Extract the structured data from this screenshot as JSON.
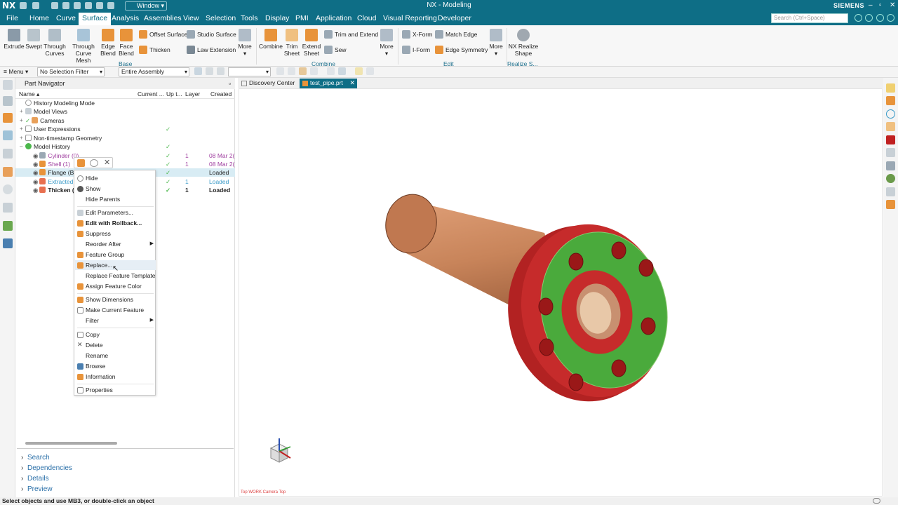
{
  "titlebar": {
    "logo": "NX",
    "window_menu": "Window",
    "title": "NX - Modeling",
    "brand": "SIEMENS"
  },
  "menubar": {
    "file": "File",
    "tabs": [
      "Home",
      "Curve",
      "Surface",
      "Analysis",
      "Assemblies",
      "View",
      "Selection",
      "Tools",
      "Display",
      "PMI",
      "Application",
      "Cloud",
      "Visual Reporting",
      "Developer"
    ],
    "active_tab": "Surface",
    "search_placeholder": "Search (Ctrl+Space)"
  },
  "ribbon": {
    "base": {
      "extrude": "Extrude",
      "swept": "Swept",
      "through_curves_1": "Through",
      "through_curves_2": "Curves",
      "through_mesh_1": "Through",
      "through_mesh_2": "Curve Mesh",
      "edge_blend_1": "Edge",
      "edge_blend_2": "Blend",
      "face_blend_1": "Face",
      "face_blend_2": "Blend",
      "offset_surface": "Offset Surface",
      "thicken": "Thicken",
      "studio_surface": "Studio Surface",
      "law_extension": "Law Extension",
      "more": "More",
      "group": "Base"
    },
    "combine": {
      "combine": "Combine",
      "trim_sheet_1": "Trim",
      "trim_sheet_2": "Sheet",
      "extend_sheet_1": "Extend",
      "extend_sheet_2": "Sheet",
      "trim_extend": "Trim and Extend",
      "sew": "Sew",
      "more": "More",
      "group": "Combine"
    },
    "edit": {
      "xform": "X-Form",
      "iform": "I-Form",
      "match_edge": "Match Edge",
      "edge_symmetry": "Edge Symmetry",
      "more": "More",
      "group": "Edit"
    },
    "realize": {
      "label_1": "NX Realize",
      "label_2": "Shape",
      "group": "Realize S..."
    }
  },
  "selection_bar": {
    "menu": "Menu",
    "filter": "No Selection Filter",
    "scope": "Entire Assembly"
  },
  "part_navigator": {
    "title": "Part Navigator",
    "columns": {
      "name": "Name",
      "current": "Current ...",
      "up_to_date": "Up t...",
      "layer": "Layer",
      "created": "Created"
    },
    "rows": [
      {
        "name": "History Modeling Mode",
        "up": "",
        "layer": "",
        "created": ""
      },
      {
        "name": "Model Views",
        "up": "",
        "layer": "",
        "created": ""
      },
      {
        "name": "Cameras",
        "up": "",
        "layer": "",
        "created": ""
      },
      {
        "name": "User Expressions",
        "up": "✓",
        "layer": "",
        "created": ""
      },
      {
        "name": "Non-timestamp Geometry",
        "up": "",
        "layer": "",
        "created": ""
      },
      {
        "name": "Model History",
        "up": "✓",
        "layer": "",
        "created": ""
      },
      {
        "name": "Cylinder (0)",
        "up": "✓",
        "layer": "1",
        "created": "08 Mar 2("
      },
      {
        "name": "Shell (1)",
        "up": "✓",
        "layer": "1",
        "created": "08 Mar 2("
      },
      {
        "name": "Flange (B1",
        "up": "✓",
        "layer": "",
        "created": "Loaded"
      },
      {
        "name": "Extracted",
        "up": "✓",
        "layer": "1",
        "created": "Loaded"
      },
      {
        "name": "Thicken (",
        "up": "✓",
        "layer": "1",
        "created": "Loaded"
      }
    ],
    "sections": [
      "Search",
      "Dependencies",
      "Details",
      "Preview"
    ]
  },
  "context_menu": {
    "items": [
      "Hide",
      "Show",
      "Hide Parents",
      "Edit Parameters...",
      "Edit with Rollback...",
      "Suppress",
      "Reorder After",
      "Feature Group",
      "Replace...",
      "Replace Feature Template",
      "Assign Feature Color",
      "Show Dimensions",
      "Make Current Feature",
      "Filter",
      "Copy",
      "Delete",
      "Rename",
      "Browse",
      "Information",
      "Properties"
    ]
  },
  "viewport": {
    "tabs": [
      "Discovery Center",
      "test_pipe.prt"
    ],
    "active_tab": "test_pipe.prt",
    "view_label": "Top WORK Camera Top"
  },
  "status": {
    "message": "Select objects and use MB3, or double-click an object"
  },
  "colors": {
    "brand": "#0e6e86",
    "pipe": "#c8845a",
    "flange_rim": "#c62b2b",
    "flange_face": "#4aaa3c"
  }
}
